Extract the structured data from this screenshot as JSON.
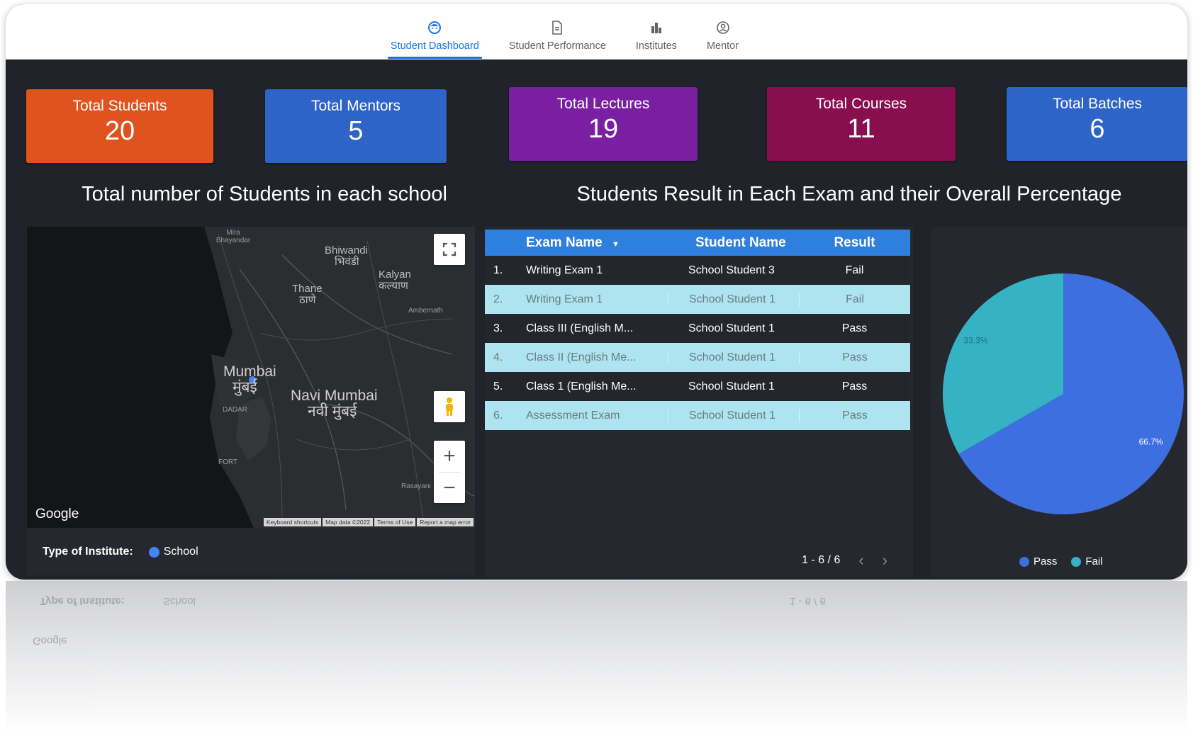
{
  "nav": {
    "tabs": [
      {
        "label": "Student Dashboard",
        "icon": "student-face-icon",
        "active": true
      },
      {
        "label": "Student Performance",
        "icon": "document-icon",
        "active": false
      },
      {
        "label": "Institutes",
        "icon": "building-icon",
        "active": false
      },
      {
        "label": "Mentor",
        "icon": "person-circle-icon",
        "active": false
      }
    ]
  },
  "kpis": [
    {
      "label": "Total Students",
      "value": "20",
      "color": "#e0531f"
    },
    {
      "label": "Total Mentors",
      "value": "5",
      "color": "#2e63c8"
    },
    {
      "label": "Total Lectures",
      "value": "19",
      "color": "#7b1fa2"
    },
    {
      "label": "Total Courses",
      "value": "11",
      "color": "#880e4f"
    },
    {
      "label": "Total Batches",
      "value": "6",
      "color": "#2e63c8"
    }
  ],
  "sections": {
    "map_title": "Total number of Students in each school",
    "exam_title": "Students Result in Each Exam and their Overall Percentage"
  },
  "map": {
    "places": {
      "mira": "Mira Bhayandar",
      "bhiwandi": "Bhiwandi",
      "bhiwandi_hi": "भिवंडी",
      "kalyan": "Kalyan",
      "kalyan_hi": "कल्याण",
      "thane": "Thane",
      "thane_hi": "ठाणे",
      "ambernath": "Ambernath",
      "mumbai": "Mumbai",
      "mumbai_hi": "मुंबई",
      "navi_mumbai": "Navi Mumbai",
      "navi_mumbai_hi": "नवी मुंबई",
      "dadar": "DADAR",
      "fort": "FORT",
      "rasayani": "Rasayani"
    },
    "google": "Google",
    "footer": [
      "Keyboard shortcuts",
      "Map data ©2022",
      "Terms of Use",
      "Report a map error"
    ],
    "legend_title": "Type of Institute:",
    "legend_item": "School",
    "legend_color": "#4285f4"
  },
  "table": {
    "headers": {
      "exam": "Exam Name",
      "student": "Student Name",
      "result": "Result"
    },
    "rows": [
      {
        "num": "1.",
        "exam": "Writing Exam 1",
        "student": "School Student 3",
        "result": "Fail"
      },
      {
        "num": "2.",
        "exam": "Writing Exam 1",
        "student": "School Student 1",
        "result": "Fail"
      },
      {
        "num": "3.",
        "exam": "Class III (English M...",
        "student": "School Student 1",
        "result": "Pass"
      },
      {
        "num": "4.",
        "exam": "Class II (English Me...",
        "student": "School Student 1",
        "result": "Pass"
      },
      {
        "num": "5.",
        "exam": "Class 1 (English Me...",
        "student": "School Student 1",
        "result": "Pass"
      },
      {
        "num": "6.",
        "exam": "Assessment Exam",
        "student": "School Student 1",
        "result": "Pass"
      }
    ],
    "pagination": "1 - 6 / 6"
  },
  "chart_data": {
    "type": "pie",
    "slices": [
      {
        "name": "Pass",
        "value": 66.7,
        "label": "66.7%",
        "color": "#3d6fe0"
      },
      {
        "name": "Fail",
        "value": 33.3,
        "label": "33.3%",
        "color": "#35b3c4"
      }
    ],
    "legend": [
      "Pass",
      "Fail"
    ],
    "legend_position": "bottom"
  }
}
